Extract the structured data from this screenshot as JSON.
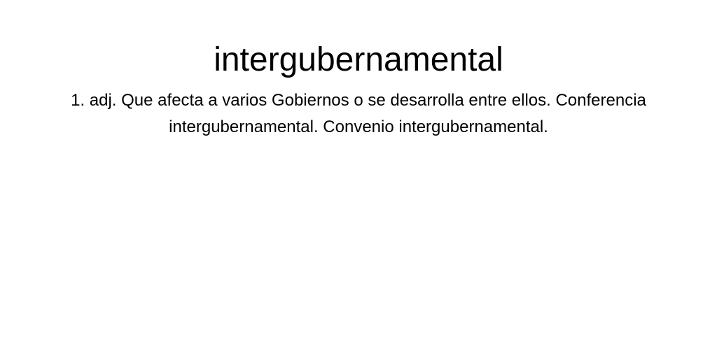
{
  "entry": {
    "headword": "intergubernamental",
    "definition": "1. adj. Que afecta a varios Gobiernos o se desarrolla entre ellos. Conferencia intergubernamental. Convenio intergubernamental."
  }
}
